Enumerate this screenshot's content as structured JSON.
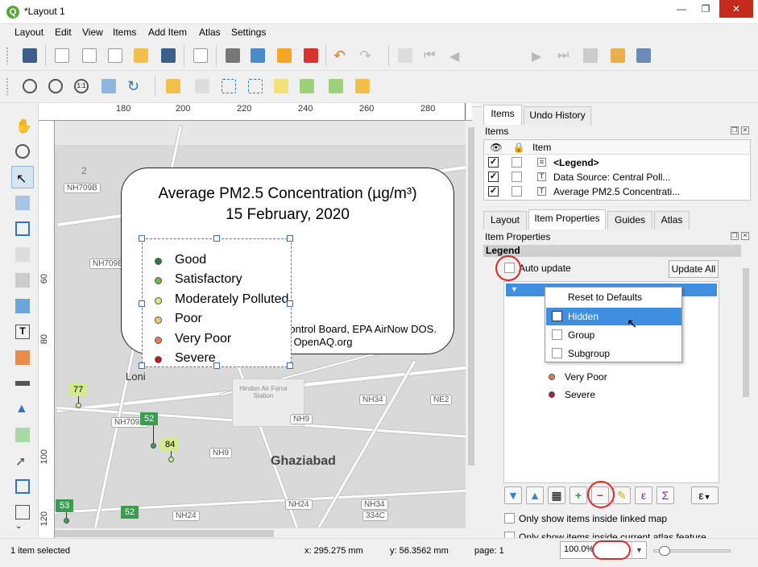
{
  "window": {
    "title": "*Layout 1",
    "app_icon": "qgis-icon"
  },
  "menu": [
    "Layout",
    "Edit",
    "View",
    "Items",
    "Add Item",
    "Atlas",
    "Settings"
  ],
  "toolbar": {
    "page_number": "1"
  },
  "rulers": {
    "h_labels": [
      "180",
      "200",
      "220",
      "240",
      "260",
      "280"
    ],
    "v_labels": [
      "60",
      "80",
      "100",
      "120"
    ]
  },
  "map": {
    "road_badges": [
      "NH709B",
      "NH709B",
      "NH709B",
      "NH34",
      "NE2",
      "NH9",
      "NH9",
      "NH24",
      "NH24",
      "NH34",
      "334C",
      "NH709B"
    ],
    "place_labels": [
      "Loni",
      "Ghaziabad",
      "Hindon Air Force Station",
      "2"
    ],
    "markers": [
      {
        "value": "77",
        "color": "#d3eb8b"
      },
      {
        "value": "52",
        "color": "#3a9c4e"
      },
      {
        "value": "84",
        "color": "#d3eb8b"
      },
      {
        "value": "53",
        "color": "#3a9c4e"
      },
      {
        "value": "52",
        "color": "#3a9c4e"
      }
    ]
  },
  "title_box": {
    "line1": "Average PM2.5 Concentration (µg/m³)",
    "line2": "15 February, 2020",
    "source1": "Control Board, EPA AirNow DOS.",
    "source2": "m OpenAQ.org"
  },
  "legend": [
    {
      "label": "Good",
      "color": "#2d7a35"
    },
    {
      "label": "Satisfactory",
      "color": "#6fb94c"
    },
    {
      "label": "Moderately Polluted",
      "color": "#d6e58c"
    },
    {
      "label": "Poor",
      "color": "#f3c66b"
    },
    {
      "label": "Very Poor",
      "color": "#e97a4f"
    },
    {
      "label": "Severe",
      "color": "#c0182a"
    }
  ],
  "right_panel": {
    "top_tabs": [
      "Items",
      "Undo History"
    ],
    "items_header": "Items",
    "column_item": "Item",
    "items": [
      {
        "label": "<Legend>",
        "visible": true,
        "locked": false
      },
      {
        "label": "Data Source: Central Poll...",
        "visible": true,
        "locked": false
      },
      {
        "label": "Average PM2.5 Concentrati...",
        "visible": true,
        "locked": false
      }
    ],
    "bottom_tabs": [
      "Layout",
      "Item Properties",
      "Guides",
      "Atlas"
    ],
    "properties_header": "Item Properties",
    "section": "Legend",
    "auto_update_label": "Auto update",
    "update_all_label": "Update All",
    "tree_items": [
      {
        "label": "Very Poor",
        "color": "#e97a4f"
      },
      {
        "label": "Severe",
        "color": "#c0182a"
      }
    ],
    "context_menu": [
      {
        "label": "Reset to Defaults",
        "checkbox": false,
        "checked": false,
        "highlighted": false
      },
      {
        "label": "Hidden",
        "checkbox": true,
        "checked": true,
        "highlighted": true
      },
      {
        "label": "Group",
        "checkbox": true,
        "checked": false,
        "highlighted": false
      },
      {
        "label": "Subgroup",
        "checkbox": true,
        "checked": false,
        "highlighted": false
      }
    ],
    "only_linked_map": "Only show items inside linked map",
    "only_atlas": "Only show items inside current atlas feature"
  },
  "status": {
    "selection": "1 item selected",
    "x": "x: 295.275 mm",
    "y": "y: 56.3562 mm",
    "page": "page: 1",
    "zoom": "100.0%"
  }
}
